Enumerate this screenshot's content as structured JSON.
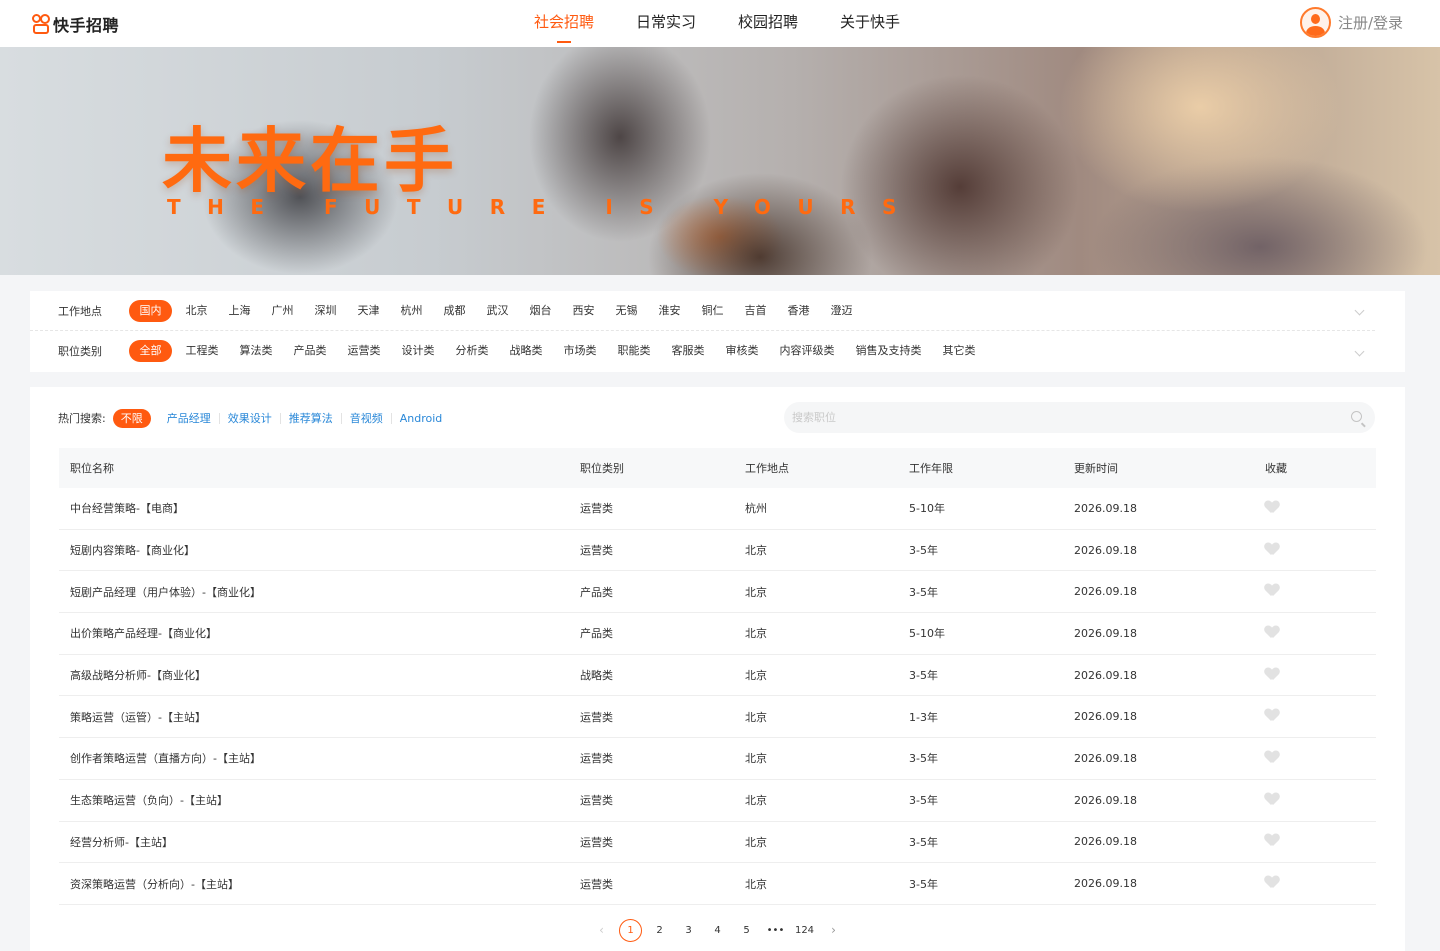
{
  "header": {
    "logo_text": "快手招聘",
    "nav": [
      "社会招聘",
      "日常实习",
      "校园招聘",
      "关于快手"
    ],
    "active_nav": 0,
    "login": "注册/登录"
  },
  "banner": {
    "title": "未来在手",
    "subtitle": "THE FUTURE IS YOURS"
  },
  "filters": {
    "location_label": "工作地点",
    "locations": [
      "国内",
      "北京",
      "上海",
      "广州",
      "深圳",
      "天津",
      "杭州",
      "成都",
      "武汉",
      "烟台",
      "西安",
      "无锡",
      "淮安",
      "铜仁",
      "吉首",
      "香港",
      "澄迈"
    ],
    "category_label": "职位类别",
    "categories": [
      "全部",
      "工程类",
      "算法类",
      "产品类",
      "运营类",
      "设计类",
      "分析类",
      "战略类",
      "市场类",
      "职能类",
      "客服类",
      "审核类",
      "内容评级类",
      "销售及支持类",
      "其它类"
    ]
  },
  "hot": {
    "label": "热门搜索:",
    "selected": "不限",
    "links": [
      "产品经理",
      "效果设计",
      "推荐算法",
      "音视频",
      "Android"
    ]
  },
  "search": {
    "placeholder": "搜索职位",
    "value": ""
  },
  "table": {
    "headers": [
      "职位名称",
      "职位类别",
      "工作地点",
      "工作年限",
      "更新时间",
      "收藏"
    ],
    "rows": [
      [
        "中台经营策略-【电商】",
        "运营类",
        "杭州",
        "5-10年",
        "2026.09.18"
      ],
      [
        "短剧内容策略-【商业化】",
        "运营类",
        "北京",
        "3-5年",
        "2026.09.18"
      ],
      [
        "短剧产品经理（用户体验）-【商业化】",
        "产品类",
        "北京",
        "3-5年",
        "2026.09.18"
      ],
      [
        "出价策略产品经理-【商业化】",
        "产品类",
        "北京",
        "5-10年",
        "2026.09.18"
      ],
      [
        "高级战略分析师-【商业化】",
        "战略类",
        "北京",
        "3-5年",
        "2026.09.18"
      ],
      [
        "策略运营（运管）-【主站】",
        "运营类",
        "北京",
        "1-3年",
        "2026.09.18"
      ],
      [
        "创作者策略运营（直播方向）-【主站】",
        "运营类",
        "北京",
        "3-5年",
        "2026.09.18"
      ],
      [
        "生态策略运营（负向）-【主站】",
        "运营类",
        "北京",
        "3-5年",
        "2026.09.18"
      ],
      [
        "经营分析师-【主站】",
        "运营类",
        "北京",
        "3-5年",
        "2026.09.18"
      ],
      [
        "资深策略运营（分析向）-【主站】",
        "运营类",
        "北京",
        "3-5年",
        "2026.09.18"
      ]
    ]
  },
  "pagination": {
    "prev": "‹",
    "pages": [
      "1",
      "2",
      "3",
      "4",
      "5"
    ],
    "current": "1",
    "ellipsis": "•••",
    "last": "124",
    "next": "›"
  },
  "colors": {
    "accent": "#ff5a10",
    "link": "#2a88d8"
  }
}
